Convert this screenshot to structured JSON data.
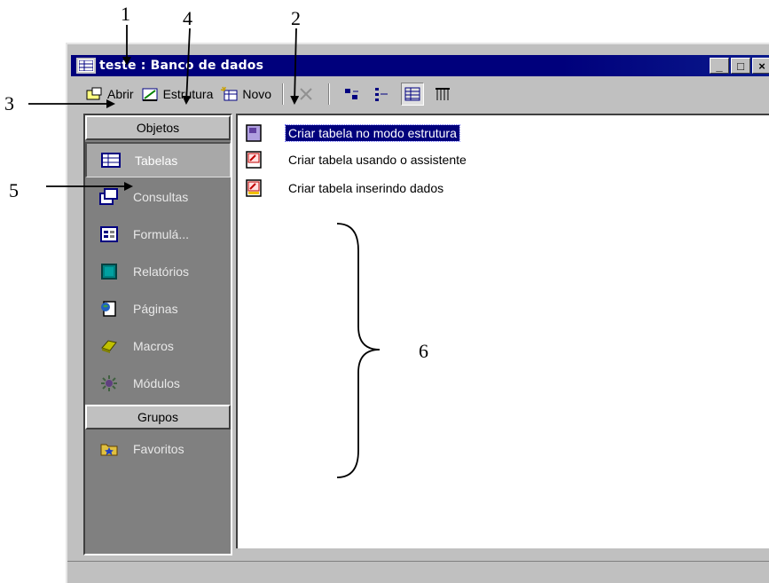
{
  "window": {
    "title": "teste : Banco de dados",
    "minimize_label": "_",
    "maximize_label": "□",
    "close_label": "×"
  },
  "toolbar": {
    "open_label": "Abrir",
    "design_label": "Estrutura",
    "new_label": "Novo"
  },
  "objbar": {
    "objects_header": "Objetos",
    "items": [
      {
        "label": "Tabelas",
        "icon": "table-icon",
        "selected": true
      },
      {
        "label": "Consultas",
        "icon": "query-icon"
      },
      {
        "label": "Formulá...",
        "icon": "form-icon"
      },
      {
        "label": "Relatórios",
        "icon": "report-icon"
      },
      {
        "label": "Páginas",
        "icon": "page-icon"
      },
      {
        "label": "Macros",
        "icon": "macro-icon"
      },
      {
        "label": "Módulos",
        "icon": "module-icon"
      }
    ],
    "groups_header": "Grupos",
    "groups": [
      {
        "label": "Favoritos",
        "icon": "favorites-folder-icon"
      }
    ]
  },
  "list": {
    "items": [
      {
        "label": "Criar tabela no modo estrutura",
        "selected": true
      },
      {
        "label": "Criar tabela usando o assistente"
      },
      {
        "label": "Criar tabela inserindo dados"
      }
    ]
  },
  "callouts": [
    "1",
    "2",
    "3",
    "4",
    "5",
    "6"
  ],
  "colors": {
    "titlebar": "#00007c",
    "window_face": "#c0c0c0",
    "objbar_bg": "#808080",
    "selection": "#00007c"
  }
}
